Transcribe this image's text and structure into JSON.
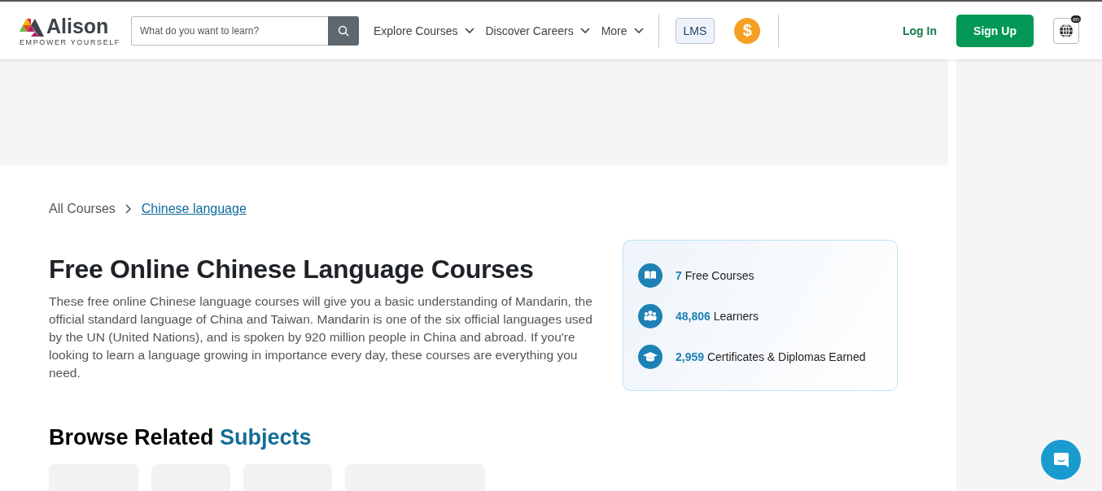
{
  "header": {
    "logo": {
      "name": "Alison",
      "tagline": "EMPOWER YOURSELF"
    },
    "search": {
      "placeholder": "What do you want to learn?"
    },
    "nav": [
      {
        "label": "Explore Courses"
      },
      {
        "label": "Discover Careers"
      },
      {
        "label": "More"
      }
    ],
    "lms": "LMS",
    "coin": "$",
    "login": "Log In",
    "signup": "Sign Up",
    "language": "en"
  },
  "breadcrumb": [
    {
      "label": "All Courses",
      "kind": "plain"
    },
    {
      "label": "Chinese language",
      "kind": "link"
    }
  ],
  "title": "Free Online Chinese Language Courses",
  "description": "These free online Chinese language courses will give you a basic understanding of Mandarin, the official standard language of China and Taiwan. Mandarin is one of the six official languages used by the UN (United Nations), and is spoken by 920 million people in China and abroad. If you're looking to learn a language growing in importance every day, these courses are everything you need.",
  "stats": [
    {
      "kind": "book",
      "value": "7",
      "label": "Free Courses"
    },
    {
      "kind": "people",
      "value": "48,806",
      "label": "Learners"
    },
    {
      "kind": "cap",
      "value": "2,959",
      "label": "Certificates & Diplomas Earned"
    }
  ],
  "related": {
    "heading": "Browse Related",
    "highlight": "Subjects",
    "cards": [
      {
        "kind": "subject"
      },
      {
        "kind": "subject"
      },
      {
        "kind": "subject"
      },
      {
        "kind": "subject"
      }
    ]
  }
}
